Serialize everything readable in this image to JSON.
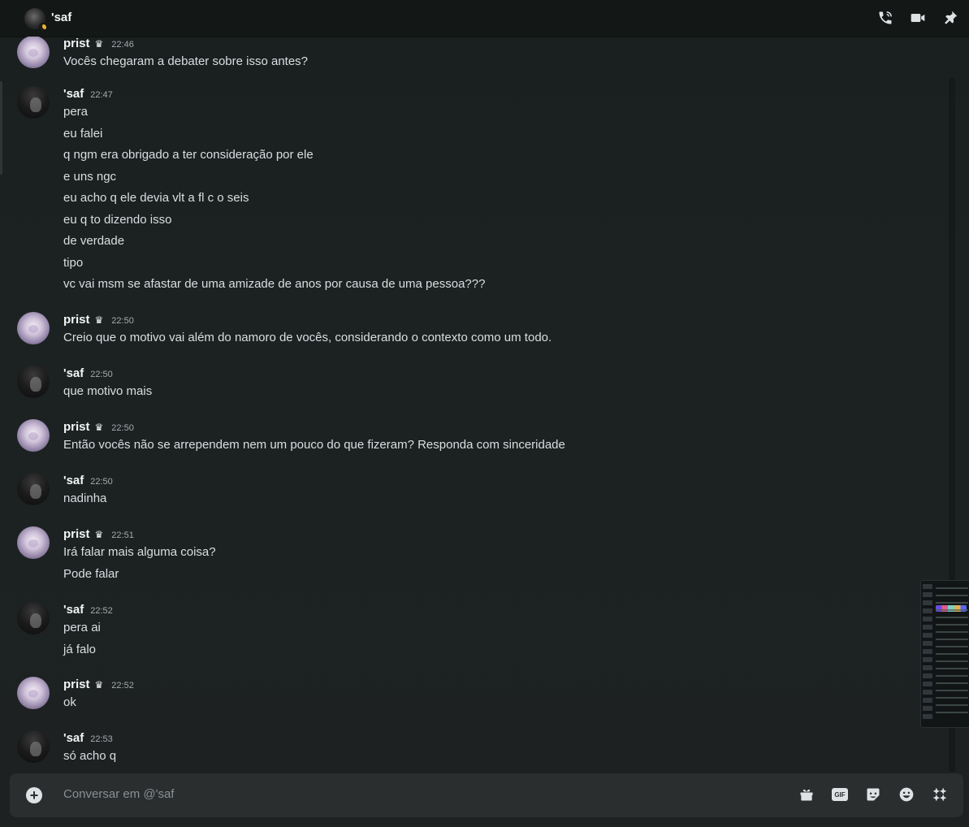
{
  "header": {
    "channel_name": "'saf",
    "icons": [
      "phone-call-icon",
      "video-call-icon",
      "pin-icon"
    ]
  },
  "messages": [
    {
      "author": "prist",
      "avatar": "prist",
      "badge": "♛",
      "time": "22:46",
      "lines": [
        "Vocês chegaram a debater sobre isso antes?"
      ]
    },
    {
      "author": "'saf",
      "avatar": "saf",
      "badge": "",
      "time": "22:47",
      "lines": [
        "pera",
        "eu falei",
        "q ngm era obrigado a ter consideração por ele",
        "e uns ngc",
        "eu acho q ele devia vlt a fl c o seis",
        "eu q to dizendo isso",
        "de verdade",
        "tipo",
        "vc vai msm se afastar de uma amizade de anos por causa de uma pessoa???"
      ]
    },
    {
      "author": "prist",
      "avatar": "prist",
      "badge": "♛",
      "time": "22:50",
      "lines": [
        "Creio que o motivo vai além do namoro de vocês, considerando o contexto como um todo."
      ]
    },
    {
      "author": "'saf",
      "avatar": "saf",
      "badge": "",
      "time": "22:50",
      "lines": [
        "que motivo mais"
      ]
    },
    {
      "author": "prist",
      "avatar": "prist",
      "badge": "♛",
      "time": "22:50",
      "lines": [
        "Então vocês não se arrependem nem um pouco do que fizeram? Responda com sinceridade"
      ]
    },
    {
      "author": "'saf",
      "avatar": "saf",
      "badge": "",
      "time": "22:50",
      "lines": [
        "nadinha"
      ]
    },
    {
      "author": "prist",
      "avatar": "prist",
      "badge": "♛",
      "time": "22:51",
      "lines": [
        "Irá falar mais alguma coisa?",
        "Pode falar"
      ]
    },
    {
      "author": "'saf",
      "avatar": "saf",
      "badge": "",
      "time": "22:52",
      "lines": [
        "pera ai",
        "já falo"
      ]
    },
    {
      "author": "prist",
      "avatar": "prist",
      "badge": "♛",
      "time": "22:52",
      "lines": [
        "ok"
      ]
    },
    {
      "author": "'saf",
      "avatar": "saf",
      "badge": "",
      "time": "22:53",
      "lines": [
        "só acho q"
      ]
    }
  ],
  "composer": {
    "placeholder": "Conversar em @'saf",
    "gif_label": "GIF",
    "icons": [
      "add-attachment-icon",
      "gift-icon",
      "gif-icon",
      "sticker-icon",
      "emoji-icon",
      "apps-icon"
    ]
  }
}
